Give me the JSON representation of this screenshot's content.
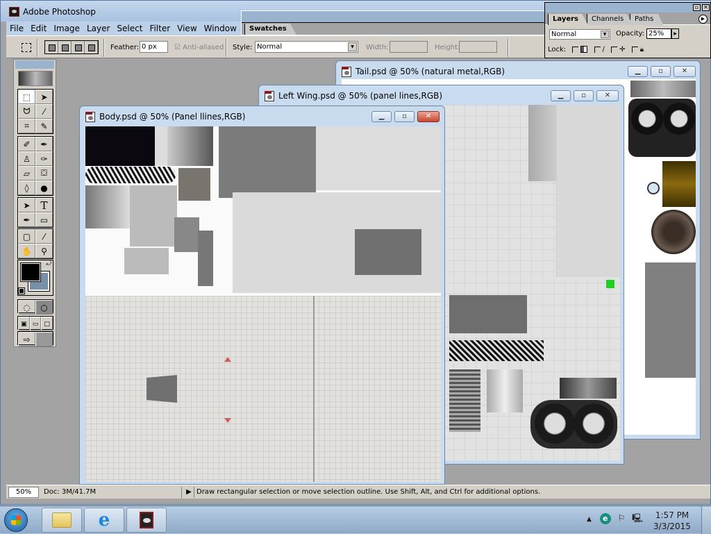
{
  "app": {
    "title": "Adobe Photoshop",
    "menu": [
      "File",
      "Edit",
      "Image",
      "Layer",
      "Select",
      "Filter",
      "View",
      "Window"
    ]
  },
  "swatches_panel": {
    "tab": "Swatches"
  },
  "options_bar": {
    "feather_label": "Feather:",
    "feather_value": "0 px",
    "anti_aliased_label": "Anti-aliased",
    "anti_aliased_checked": true,
    "style_label": "Style:",
    "style_value": "Normal",
    "width_label": "Width:",
    "height_label": "Height:",
    "width_value": "",
    "height_value": ""
  },
  "layers_panel": {
    "tabs": [
      "Layers",
      "Channels",
      "Paths"
    ],
    "active_tab": "Layers",
    "blend_mode": "Normal",
    "opacity_label": "Opacity:",
    "opacity_value": "25%",
    "lock_label": "Lock:"
  },
  "toolbox": {
    "tools": [
      [
        "rectangular-marquee",
        "move"
      ],
      [
        "lasso",
        "magic-wand"
      ],
      [
        "crop",
        "slice"
      ],
      [
        "healing-brush",
        "brush"
      ],
      [
        "clone-stamp",
        "history-brush"
      ],
      [
        "eraser",
        "paint-bucket"
      ],
      [
        "blur",
        "dodge"
      ],
      [
        "path-selection",
        "type"
      ],
      [
        "pen",
        "rectangle"
      ],
      [
        "notes",
        "eyedropper"
      ],
      [
        "hand",
        "zoom"
      ]
    ],
    "foreground_color": "#000000",
    "background_color": "#7890a8"
  },
  "documents": [
    {
      "title": "Tail.psd @ 50% (natural metal,RGB)"
    },
    {
      "title": "Left Wing.psd @ 50% (panel lines,RGB)"
    },
    {
      "title": "Body.psd @ 50% (Panel llines,RGB)"
    }
  ],
  "status_bar": {
    "zoom": "50%",
    "doc_size": "Doc: 3M/41.7M",
    "message": "Draw rectangular selection or move selection outline.  Use Shift, Alt, and Ctrl for additional options."
  },
  "taskbar": {
    "time": "1:57 PM",
    "date": "3/3/2015",
    "pinned": [
      "Windows Explorer",
      "Internet Explorer",
      "Adobe Photoshop"
    ]
  }
}
